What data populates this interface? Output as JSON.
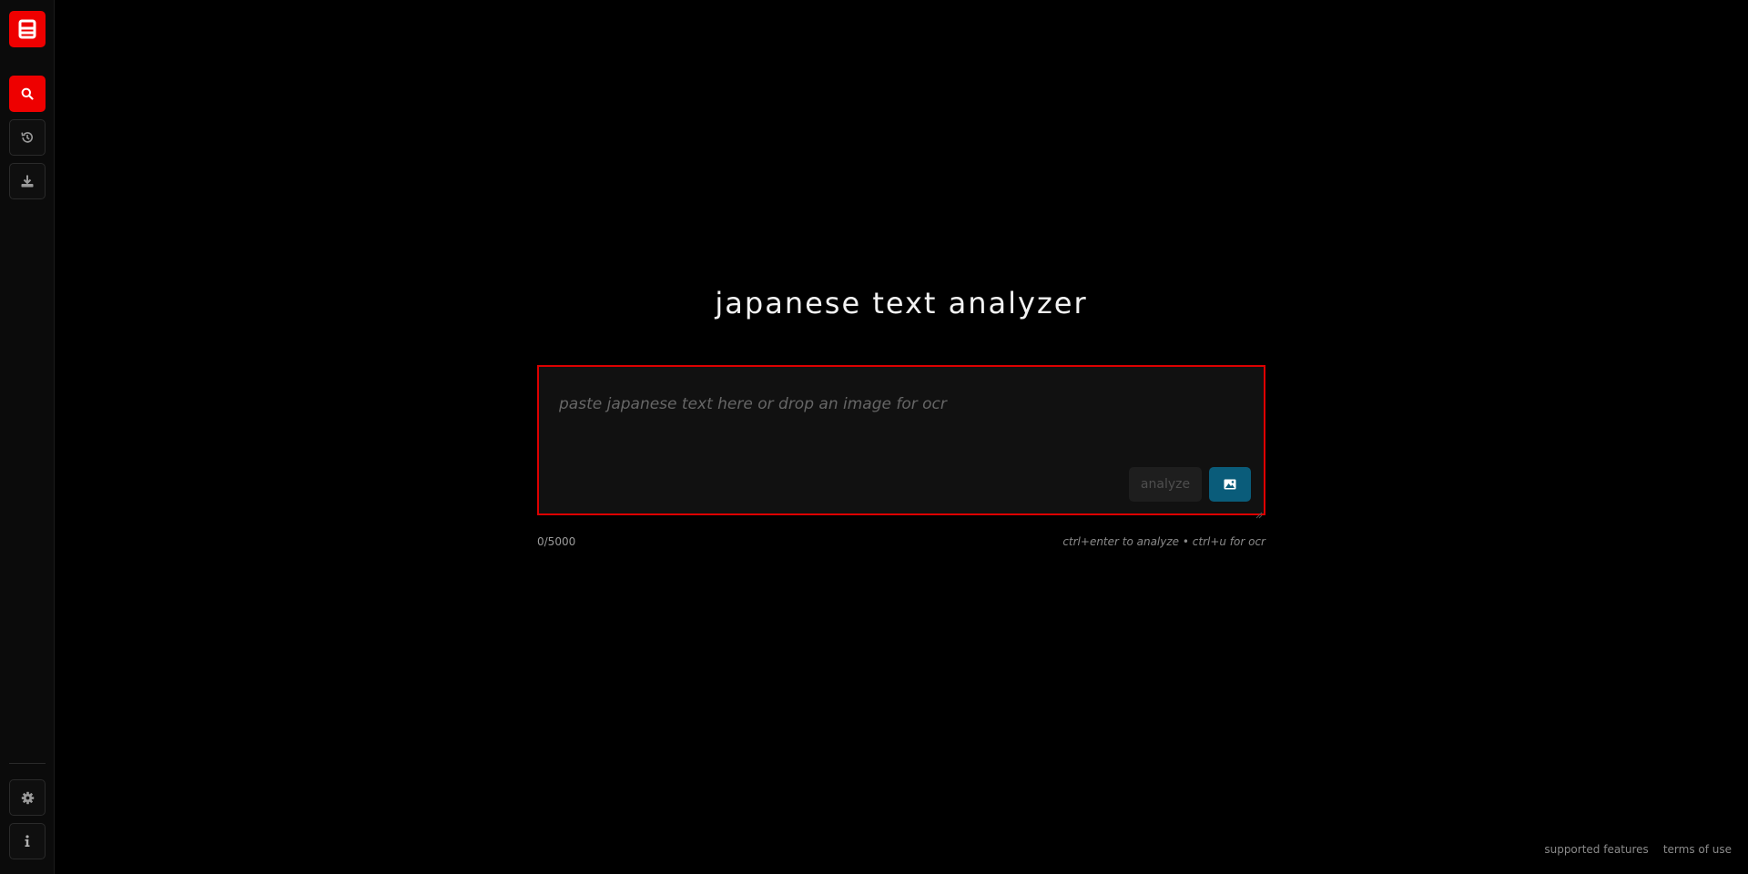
{
  "sidebar": {
    "logo_icon": "app-logo-icon",
    "items": [
      {
        "name": "search",
        "icon": "search-icon",
        "active": true
      },
      {
        "name": "history",
        "icon": "history-icon",
        "active": false
      },
      {
        "name": "download",
        "icon": "download-icon",
        "active": false
      }
    ],
    "bottom_items": [
      {
        "name": "settings",
        "icon": "gear-icon"
      },
      {
        "name": "info",
        "icon": "info-icon"
      }
    ]
  },
  "main": {
    "title": "japanese text analyzer",
    "input": {
      "placeholder": "paste japanese text here or drop an image for ocr",
      "value": ""
    },
    "analyze_label": "analyze",
    "ocr_icon": "image-icon",
    "char_count": "0/5000",
    "shortcut_hint": "ctrl+enter to analyze • ctrl+u for ocr"
  },
  "footer": {
    "links": [
      "supported features",
      "terms of use"
    ]
  },
  "colors": {
    "accent": "#ee0000",
    "ocr_button": "#0a5c7a",
    "background": "#000000",
    "sidebar": "#0b0b0b",
    "input_background": "#111111"
  }
}
